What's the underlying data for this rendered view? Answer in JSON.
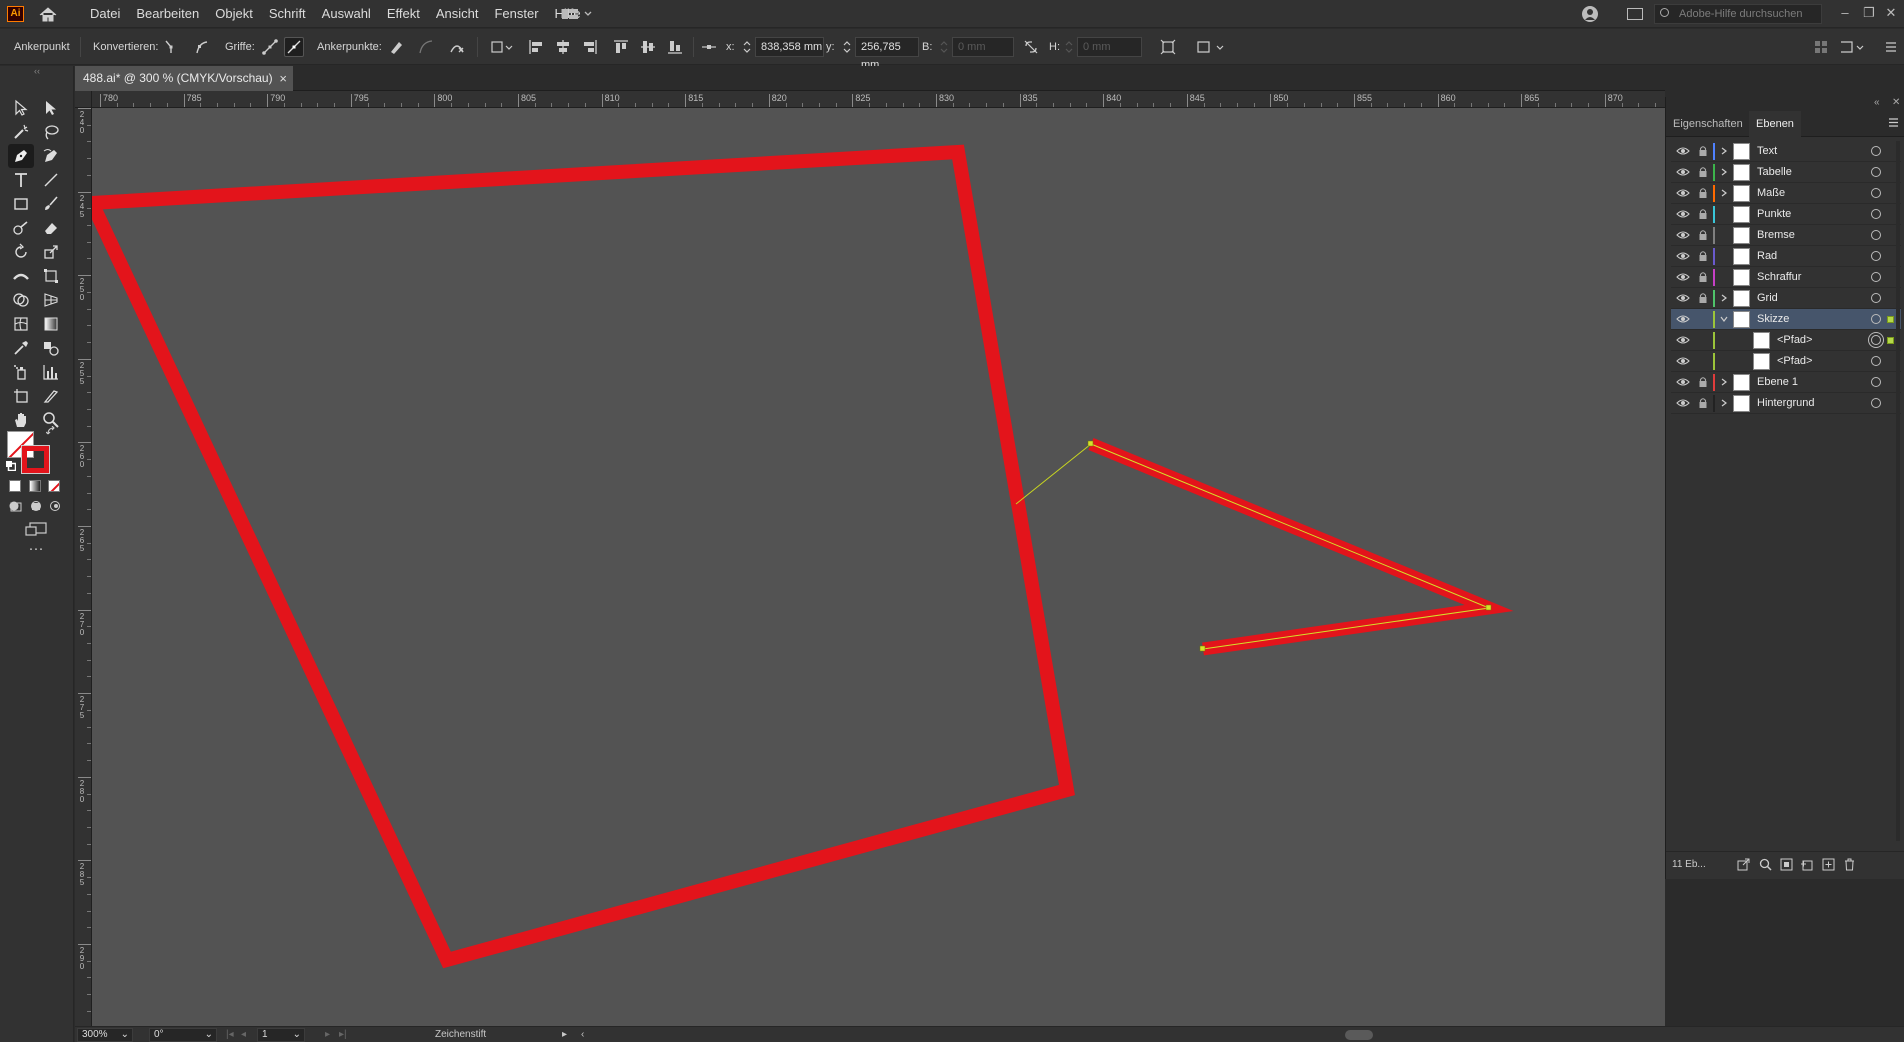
{
  "app": {
    "logo_text": "Ai"
  },
  "menu": [
    "Datei",
    "Bearbeiten",
    "Objekt",
    "Schrift",
    "Auswahl",
    "Effekt",
    "Ansicht",
    "Fenster",
    "Hilfe"
  ],
  "help_search": {
    "placeholder": "Adobe-Hilfe durchsuchen"
  },
  "control_bar": {
    "mode_label": "Ankerpunkt",
    "convert_label": "Konvertieren:",
    "handles_label": "Griffe:",
    "anchors_label": "Ankerpunkte:",
    "x_label": "x:",
    "x_value": "838,358 mm",
    "y_label": "y:",
    "y_value": "256,785 mm",
    "w_label": "B:",
    "w_value": "0 mm",
    "h_label": "H:",
    "h_value": "0 mm"
  },
  "document": {
    "tab_title": "488.ai* @ 300 % (CMYK/Vorschau)",
    "close_glyph": "×"
  },
  "ruler": {
    "h_labels": [
      "780",
      "785",
      "790",
      "795",
      "800",
      "805",
      "810",
      "815",
      "820",
      "825",
      "830",
      "835",
      "840",
      "845",
      "850",
      "855",
      "860",
      "865",
      "870"
    ],
    "v_labels": [
      "240",
      "245",
      "250",
      "255",
      "260",
      "265",
      "270",
      "275",
      "280",
      "285",
      "290"
    ]
  },
  "status_bar": {
    "zoom": "300%",
    "rotation": "0°",
    "artboard": "1",
    "current_tool": "Zeichenstift"
  },
  "panel": {
    "tabs": [
      "Eigenschaften",
      "Ebenen"
    ],
    "active_tab": "Ebenen",
    "layer_count": "11 Eb...",
    "layers": [
      {
        "name": "Text",
        "color": "#4f81ff",
        "expandable": true,
        "locked": true,
        "sub": false
      },
      {
        "name": "Tabelle",
        "color": "#3cb44b",
        "expandable": true,
        "locked": true,
        "sub": false
      },
      {
        "name": "Maße",
        "color": "#ff6a00",
        "expandable": true,
        "locked": true,
        "sub": false
      },
      {
        "name": "Punkte",
        "color": "#39c6d9",
        "expandable": false,
        "locked": true,
        "sub": false
      },
      {
        "name": "Bremse",
        "color": "#7f7f7f",
        "expandable": false,
        "locked": true,
        "sub": false
      },
      {
        "name": "Rad",
        "color": "#6a5acd",
        "expandable": false,
        "locked": true,
        "sub": false
      },
      {
        "name": "Schraffur",
        "color": "#c640c6",
        "expandable": false,
        "locked": true,
        "sub": false
      },
      {
        "name": "Grid",
        "color": "#4fc36a",
        "expandable": true,
        "locked": true,
        "sub": false
      },
      {
        "name": "Skizze",
        "color": "#9bc43a",
        "expandable": true,
        "locked": false,
        "sub": false,
        "selected": true
      },
      {
        "name": "<Pfad>",
        "color": "#9bc43a",
        "expandable": false,
        "locked": false,
        "sub": true,
        "targeted": true
      },
      {
        "name": "<Pfad>",
        "color": "#9bc43a",
        "expandable": false,
        "locked": false,
        "sub": true
      },
      {
        "name": "Ebene 1",
        "color": "#e03c3c",
        "expandable": true,
        "locked": true,
        "sub": false
      },
      {
        "name": "Hintergrund",
        "color": "#222222",
        "expandable": true,
        "locked": true,
        "sub": false
      }
    ]
  },
  "colors": {
    "stroke": "#e3141b",
    "selection": "#b6d94a",
    "canvas": "#535353"
  }
}
